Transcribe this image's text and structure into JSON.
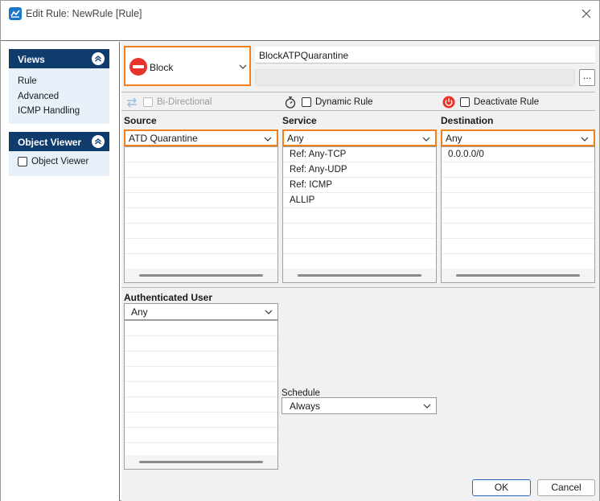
{
  "window": {
    "title": "Edit Rule: NewRule [Rule]"
  },
  "sidebar": {
    "views": {
      "title": "Views",
      "items": [
        "Rule",
        "Advanced",
        "ICMP Handling"
      ]
    },
    "object_viewer": {
      "title": "Object Viewer",
      "checkbox_label": "Object Viewer",
      "checked": false
    }
  },
  "rule": {
    "action": "Block",
    "name": "BlockATPQuarantine",
    "comment": "",
    "more_label": "...",
    "options": {
      "bidirectional": {
        "label": "Bi-Directional",
        "enabled": false,
        "checked": false
      },
      "dynamic": {
        "label": "Dynamic Rule",
        "checked": false
      },
      "deactivate": {
        "label": "Deactivate Rule",
        "checked": false
      }
    }
  },
  "source": {
    "header": "Source",
    "selected": "ATD Quarantine",
    "items": []
  },
  "service": {
    "header": "Service",
    "selected": "Any",
    "items": [
      "Ref: Any-TCP",
      "Ref: Any-UDP",
      "Ref: ICMP",
      "ALLIP"
    ]
  },
  "destination": {
    "header": "Destination",
    "selected": "Any",
    "items": [
      "0.0.0.0/0"
    ]
  },
  "auth_user": {
    "header": "Authenticated User",
    "selected": "Any",
    "items": []
  },
  "schedule": {
    "label": "Schedule",
    "selected": "Always"
  },
  "buttons": {
    "ok": "OK",
    "cancel": "Cancel"
  },
  "colors": {
    "accent_orange": "#f07f1e",
    "nav_header": "#0f3b6d",
    "block_red": "#e8332a",
    "primary_border": "#2b6cbe"
  }
}
